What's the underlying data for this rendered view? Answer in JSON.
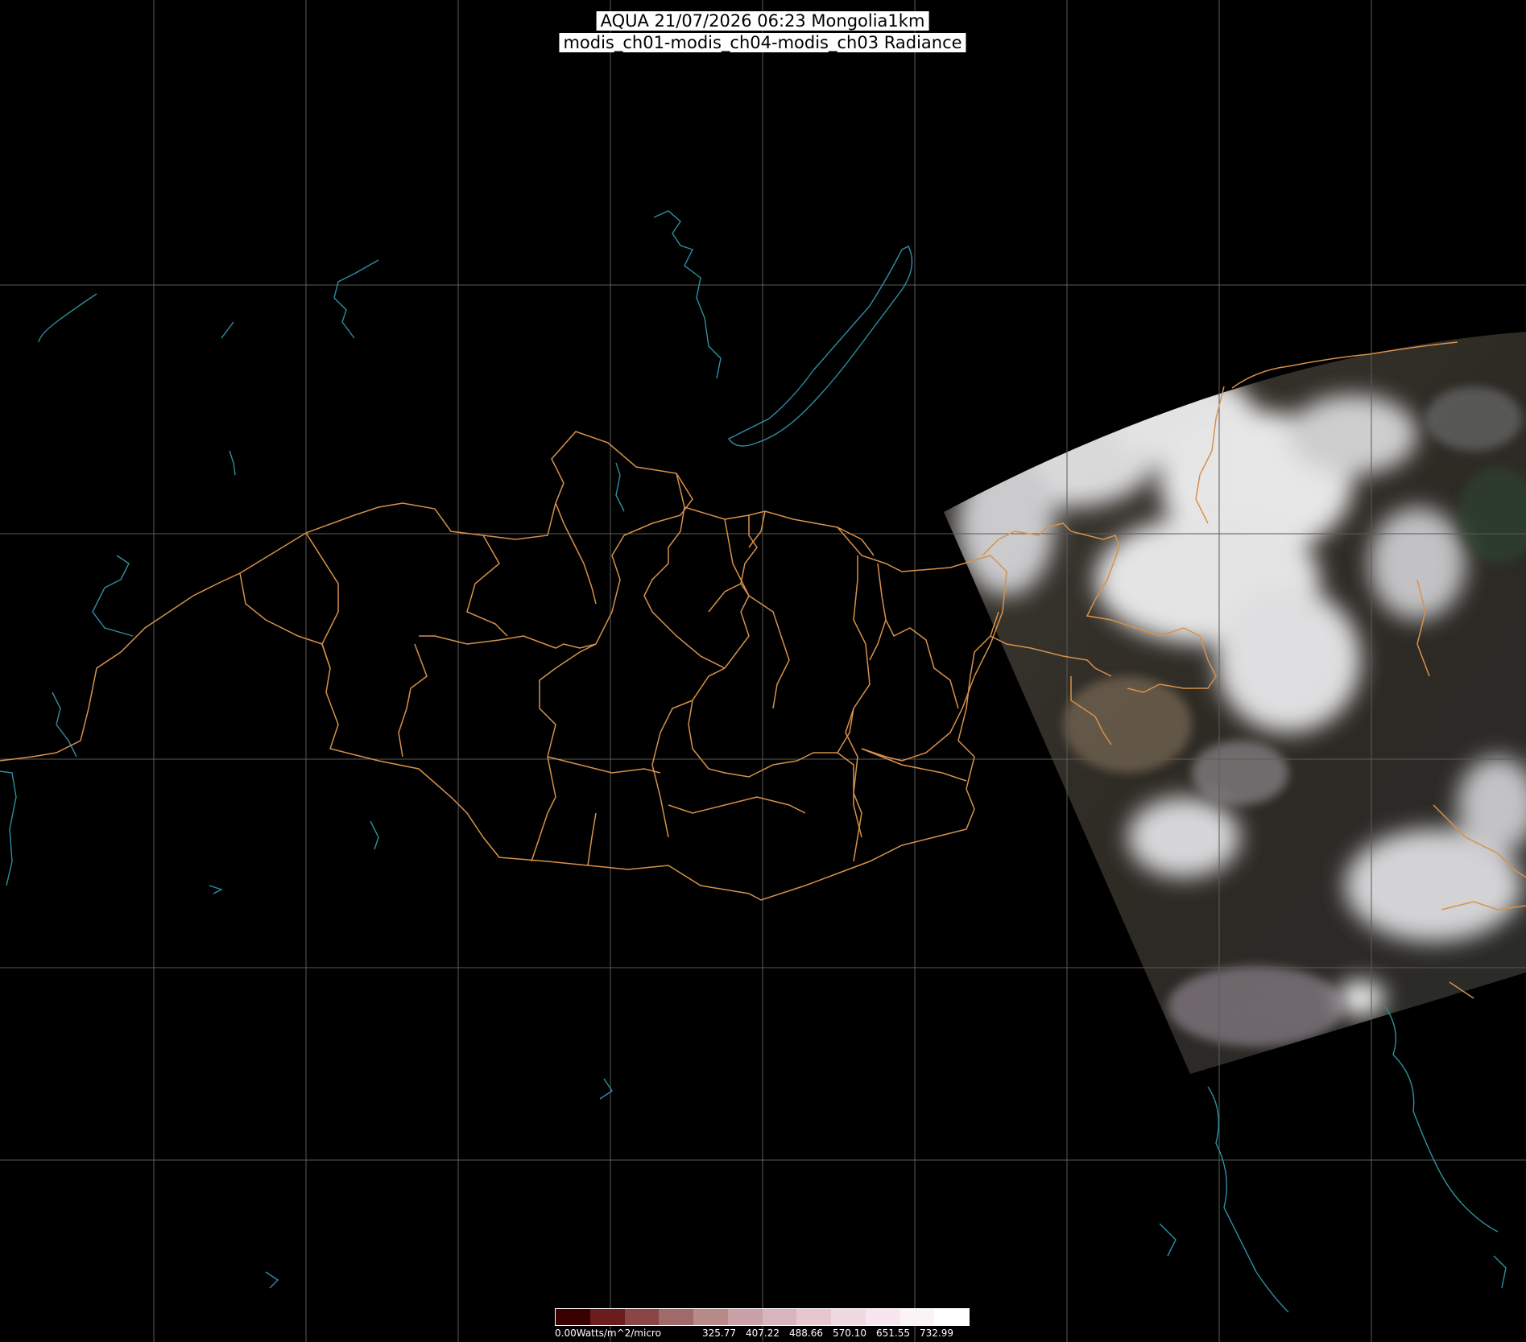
{
  "title": {
    "line1": "AQUA 21/07/2026 06:23 Mongolia1km",
    "line2": "modis_ch01-modis_ch04-modis_ch03 Radiance"
  },
  "colors": {
    "background": "#000000",
    "graticule": "#5a5a5a",
    "borders": "#d8914a",
    "coastlines": "#2f8fa0",
    "title_bg": "#ffffff"
  },
  "legend": {
    "unit_label": "0.00Watts/m^2/micro",
    "tick_labels": [
      "325.77",
      "407.22",
      "488.66",
      "570.10",
      "651.55",
      "732.99"
    ],
    "colors": [
      "#3a0000",
      "#6b1c1c",
      "#8a4545",
      "#a06a6a",
      "#b88a8a",
      "#c9a1a6",
      "#d8b4bc",
      "#e6c7d0",
      "#f0d8e0",
      "#f7e6ee",
      "#fcf3f7",
      "#ffffff"
    ]
  }
}
